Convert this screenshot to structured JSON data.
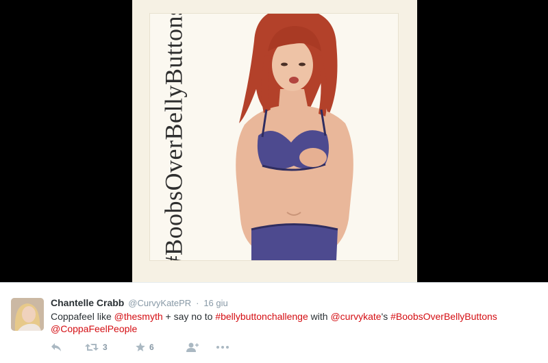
{
  "media": {
    "overlay_hashtag": "#BoobsOverBellyButtons"
  },
  "tweet": {
    "author": {
      "name": "Chantelle Crabb",
      "handle": "@CurvyKatePR"
    },
    "separator": "·",
    "timestamp": "16 giu",
    "text": {
      "part1": "Coppafeel like ",
      "mention1": "@thesmyth",
      "part2": " + say no to ",
      "hashtag1": "#bellybuttonchallenge",
      "part3": " with ",
      "mention2": "@curvykate",
      "part4": "'s ",
      "hashtag2": "#BoobsOverBellyButtons",
      "mention3": "@CoppaFeelPeople"
    },
    "actions": {
      "retweet_count": "3",
      "favorite_count": "6"
    }
  },
  "colors": {
    "link": "#d40d12",
    "text": "#292f33",
    "muted": "#8899a6",
    "icon": "#aab8c2",
    "stage_background": "#000000"
  },
  "icons": [
    "reply-icon",
    "retweet-icon",
    "favorite-star-icon",
    "follow-icon",
    "more-icon"
  ]
}
